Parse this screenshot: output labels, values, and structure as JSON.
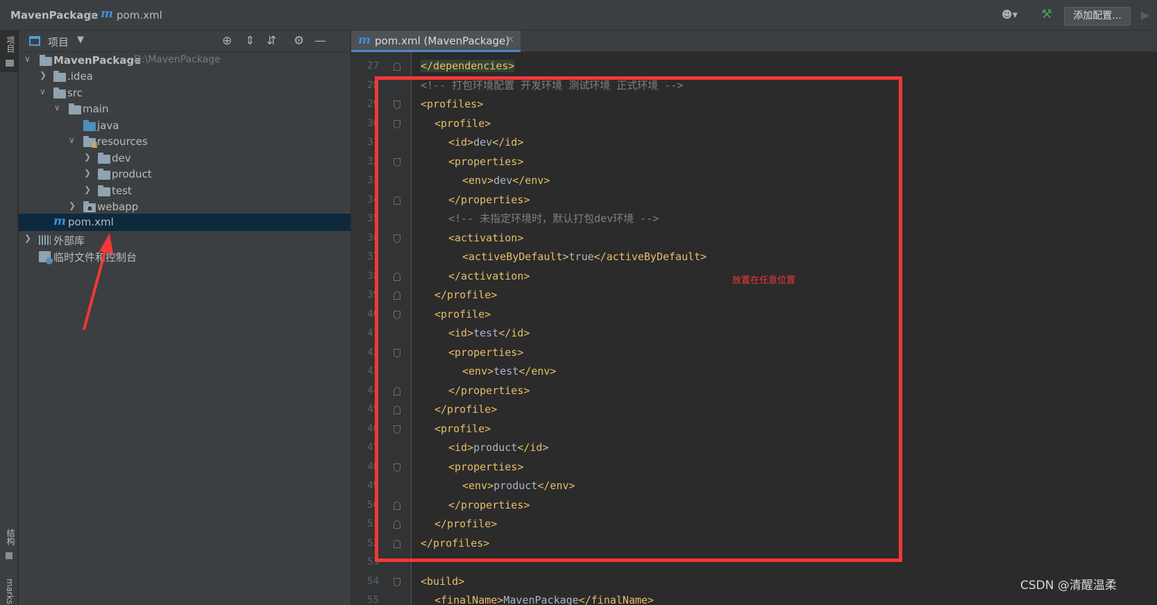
{
  "navbar": {
    "project": "MavenPackage",
    "file_icon": "m",
    "file": "pom.xml",
    "config_button": "添加配置..."
  },
  "toolstrip": {
    "project_label": "项目",
    "structure_label": "结构",
    "bookmarks_label": "marks"
  },
  "project_panel": {
    "title": "项目",
    "tree": [
      {
        "label": "MavenPackage",
        "path": "D:\\MavenPackage"
      },
      {
        "label": ".idea"
      },
      {
        "label": "src"
      },
      {
        "label": "main"
      },
      {
        "label": "java"
      },
      {
        "label": "resources"
      },
      {
        "label": "dev"
      },
      {
        "label": "product"
      },
      {
        "label": "test"
      },
      {
        "label": "webapp"
      },
      {
        "label": "pom.xml",
        "icon": "m"
      },
      {
        "label": "外部库"
      },
      {
        "label": "临时文件和控制台"
      }
    ]
  },
  "editor": {
    "tab_label": "pom.xml (MavenPackage)",
    "tab_icon": "m",
    "lines": [
      {
        "n": "27",
        "text": "</dependencies>"
      },
      {
        "n": "28",
        "text": "<!-- 打包环境配置 开发环境 测试环境 正式环境 -->"
      },
      {
        "n": "29",
        "text": "<profiles>"
      },
      {
        "n": "30",
        "text": "<profile>"
      },
      {
        "n": "31",
        "open": "<id>",
        "value": "dev",
        "close": "</id>"
      },
      {
        "n": "32",
        "text": "<properties>"
      },
      {
        "n": "33",
        "open": "<env>",
        "value": "dev",
        "close": "</env>"
      },
      {
        "n": "34",
        "text": "</properties>"
      },
      {
        "n": "35",
        "text": "<!-- 未指定环境时，默认打包dev环境 -->"
      },
      {
        "n": "36",
        "text": "<activation>"
      },
      {
        "n": "37",
        "open": "<activeByDefault>",
        "value": "true",
        "close": "</activeByDefault>"
      },
      {
        "n": "38",
        "text": "</activation>"
      },
      {
        "n": "39",
        "text": "</profile>"
      },
      {
        "n": "40",
        "text": "<profile>"
      },
      {
        "n": "41",
        "open": "<id>",
        "value": "test",
        "close": "</id>"
      },
      {
        "n": "42",
        "text": "<properties>"
      },
      {
        "n": "43",
        "open": "<env>",
        "value": "test",
        "close": "</env>"
      },
      {
        "n": "44",
        "text": "</properties>"
      },
      {
        "n": "45",
        "text": "</profile>"
      },
      {
        "n": "46",
        "text": "<profile>"
      },
      {
        "n": "47",
        "open": "<id>",
        "value": "product",
        "close": "</id>"
      },
      {
        "n": "48",
        "text": "<properties>"
      },
      {
        "n": "49",
        "open": "<env>",
        "value": "product",
        "close": "</env>"
      },
      {
        "n": "50",
        "text": "</properties>"
      },
      {
        "n": "51",
        "text": "</profile>"
      },
      {
        "n": "52",
        "text": "</profiles>"
      },
      {
        "n": "53",
        "text": ""
      },
      {
        "n": "54",
        "text": "<build>"
      },
      {
        "n": "55",
        "open": "<finalName>",
        "value": "MavenPackage",
        "close": "</finalName>"
      }
    ]
  },
  "annotation": {
    "note": "放置在任意位置",
    "color": "#f23838"
  },
  "watermark": "CSDN @清醒温柔",
  "colors": {
    "tag": "#e8bf6a",
    "text": "#a9b7c6",
    "comment": "#808080",
    "accent": "#4a88c7"
  }
}
